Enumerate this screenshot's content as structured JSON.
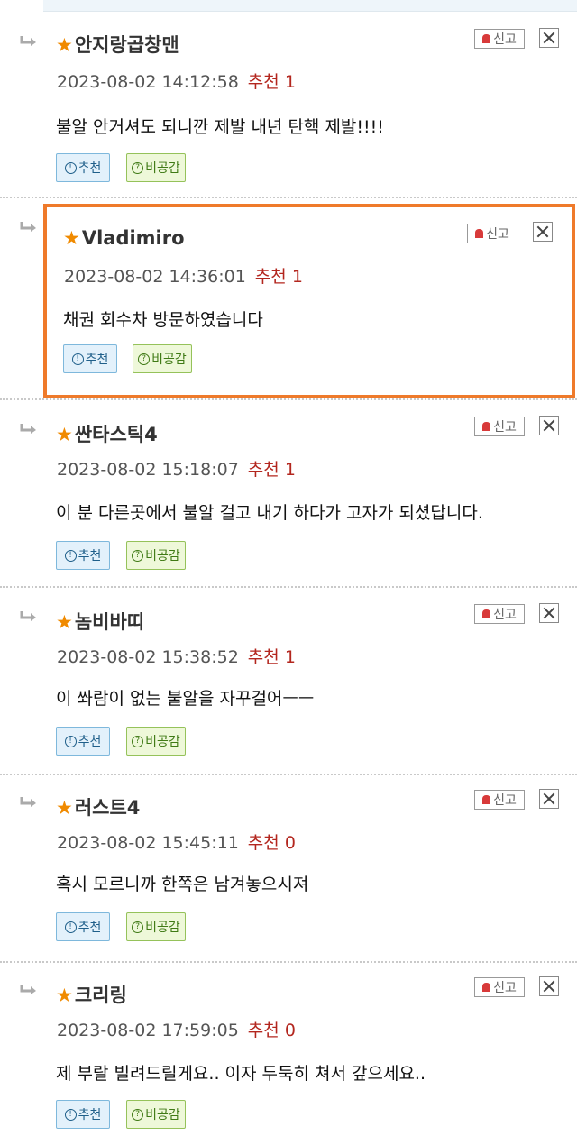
{
  "labels": {
    "recommend_button": "추천",
    "disagree_button": "비공감",
    "report_button": "신고",
    "recommend_prefix": "추천"
  },
  "comments": [
    {
      "author": "안지랑곱창맨",
      "datetime": "2023-08-02 14:12:58",
      "recommend_count": "1",
      "text": "불알 안거셔도 되니깐 제발 내년 탄핵 제발!!!!",
      "highlighted": false
    },
    {
      "author": "Vladimiro",
      "datetime": "2023-08-02 14:36:01",
      "recommend_count": "1",
      "text": "채권 회수차 방문하였습니다",
      "highlighted": true
    },
    {
      "author": "싼타스틱4",
      "datetime": "2023-08-02 15:18:07",
      "recommend_count": "1",
      "text": "이 분 다른곳에서 불알 걸고 내기 하다가 고자가 되셨답니다.",
      "highlighted": false
    },
    {
      "author": "놈비바띠",
      "datetime": "2023-08-02 15:38:52",
      "recommend_count": "1",
      "text": "이 쏴람이 없는 불알을 자꾸걸어ㅡㅡ",
      "highlighted": false
    },
    {
      "author": "러스트4",
      "datetime": "2023-08-02 15:45:11",
      "recommend_count": "0",
      "text": "혹시 모르니까 한쪽은 남겨놓으시져",
      "highlighted": false
    },
    {
      "author": "크리링",
      "datetime": "2023-08-02 17:59:05",
      "recommend_count": "0",
      "text": "제 부랄 빌려드릴게요.. 이자 두둑히 쳐서 갚으세요..",
      "highlighted": false
    }
  ],
  "colors": {
    "highlight_border": "#ef7a2a",
    "star": "#f08a00",
    "recommend_text": "#b3261e"
  }
}
